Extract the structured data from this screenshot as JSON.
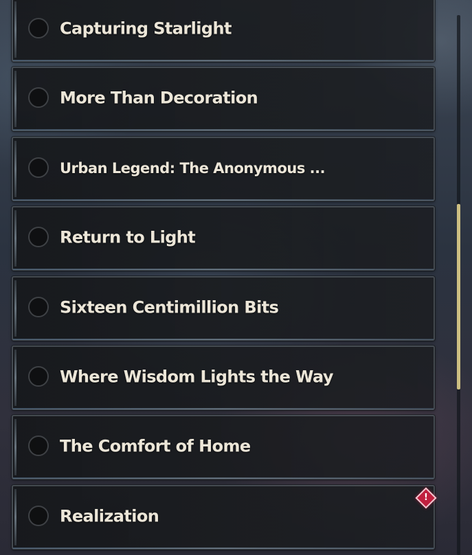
{
  "quest_list": {
    "items": [
      {
        "title": "Capturing Starlight",
        "completed": false
      },
      {
        "title": "More Than Decoration",
        "completed": false
      },
      {
        "title": "Urban Legend: The Anonymous ...",
        "completed": false
      },
      {
        "title": "Return to Light",
        "completed": false
      },
      {
        "title": "Sixteen Centimillion Bits",
        "completed": false
      },
      {
        "title": "Where Wisdom Lights the Way",
        "completed": false
      },
      {
        "title": "The Comfort of Home",
        "completed": false
      },
      {
        "title": "Realization",
        "completed": false,
        "alert": "!"
      }
    ]
  },
  "scrollbar": {
    "thumb_start_fraction": 0.35,
    "thumb_length_fraction": 0.343
  },
  "colors": {
    "title_text": "#ece6d8",
    "scroll_thumb": "#cdbf82",
    "alert_badge": "#c0203f"
  },
  "icons": {
    "checkbox": "circle-checkbox-icon",
    "alert": "exclamation-diamond-icon"
  }
}
